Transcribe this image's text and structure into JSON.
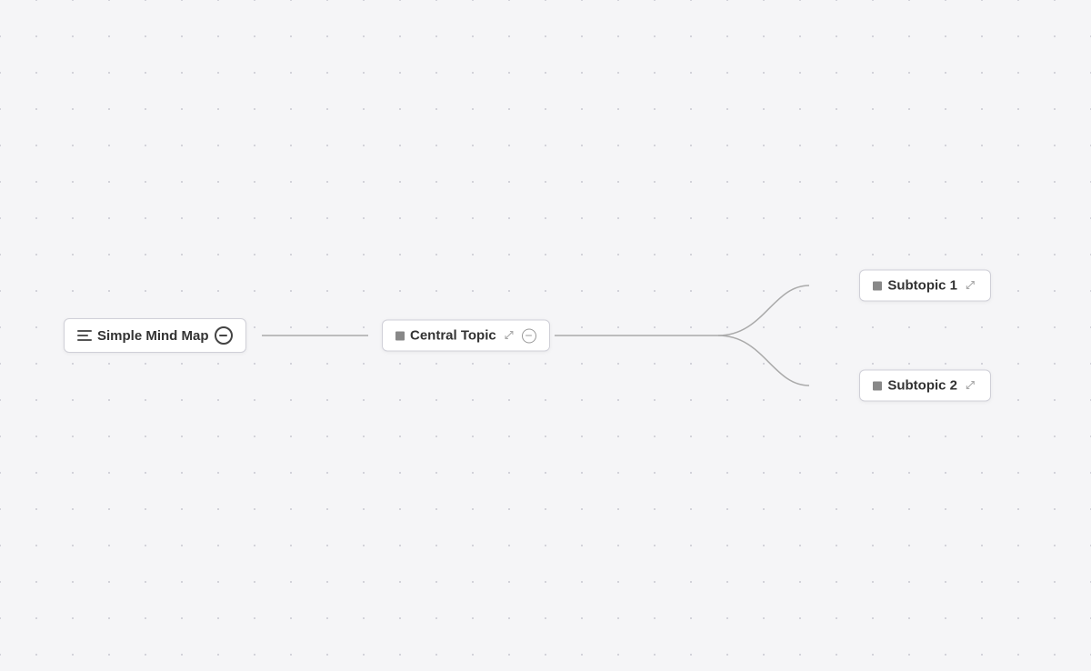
{
  "mindmap": {
    "title": "Simple Mind Map",
    "root": {
      "label": "Simple Mind Map",
      "id": "root"
    },
    "central": {
      "label": "Central Topic",
      "id": "central"
    },
    "subtopics": [
      {
        "label": "Subtopic 1",
        "id": "subtopic1"
      },
      {
        "label": "Subtopic 2",
        "id": "subtopic2"
      }
    ],
    "icons": {
      "hamburger": "hamburger-icon",
      "collapse": "collapse-button",
      "expand": "expand-icon"
    }
  }
}
